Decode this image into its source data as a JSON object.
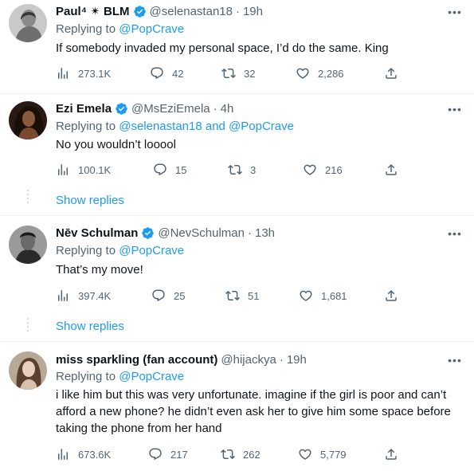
{
  "tweets": [
    {
      "name": "Paul⁴ ✴ BLM",
      "handle": "@selenastan18",
      "sep": "·",
      "time": "19h",
      "replying_prefix": "Replying to ",
      "replying_mentions": "@PopCrave",
      "text": "If somebody invaded my personal space, I’d do the same. King",
      "views": "273.1K",
      "replies": "42",
      "retweets": "32",
      "likes": "2,286"
    },
    {
      "name": "Ezi Emela",
      "handle": "@MsEziEmela",
      "sep": "·",
      "time": "4h",
      "replying_prefix": "Replying to ",
      "replying_mentions": "@selenastan18 and @PopCrave",
      "text": "No you wouldn’t looool",
      "views": "100.1K",
      "replies": "15",
      "retweets": "3",
      "likes": "216",
      "show_replies": "Show replies"
    },
    {
      "name": "Nēv Schulman",
      "handle": "@NevSchulman",
      "sep": "·",
      "time": "13h",
      "replying_prefix": "Replying to ",
      "replying_mentions": "@PopCrave",
      "text": "That’s my move!",
      "views": "397.4K",
      "replies": "25",
      "retweets": "51",
      "likes": "1,681",
      "show_replies": "Show replies"
    },
    {
      "name": "miss sparkling (fan account)",
      "handle": "@hijackya",
      "sep": "·",
      "time": "19h",
      "replying_prefix": "Replying to ",
      "replying_mentions": "@PopCrave",
      "text": "i like him but this was very unfortunate. imagine if the girl is poor and can’t afford a new phone? he didn’t even ask her to give him some space before taking the phone from her hand",
      "views": "673.6K",
      "replies": "217",
      "retweets": "262",
      "likes": "5,779"
    }
  ],
  "icons": {
    "more": "more-icon",
    "verified": "verified-badge-icon",
    "views": "views-icon",
    "reply": "reply-icon",
    "retweet": "retweet-icon",
    "like": "like-icon",
    "share": "share-icon"
  },
  "colors": {
    "link": "#1d9bf0",
    "secondary": "#536471",
    "verified": "#1d9bf0",
    "divider": "#eff3f4"
  }
}
